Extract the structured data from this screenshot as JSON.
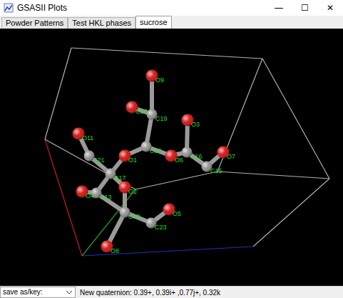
{
  "window": {
    "title": "GSASII Plots",
    "controls": [
      "—",
      "☐",
      "✕"
    ]
  },
  "tabs": [
    {
      "label": "Powder Patterns",
      "selected": false
    },
    {
      "label": "Test HKL phases",
      "selected": false
    },
    {
      "label": "sucrose",
      "selected": true
    }
  ],
  "molecule": {
    "atoms": [
      {
        "label": "O9",
        "color": "#d40000"
      },
      {
        "label": "O10",
        "color": "#d40000"
      },
      {
        "label": "C19",
        "color": "#8a8a8a"
      },
      {
        "label": "O3",
        "color": "#d40000"
      },
      {
        "label": "C12",
        "color": "#8a8a8a"
      },
      {
        "label": "O1",
        "color": "#d40000"
      },
      {
        "label": "O6",
        "color": "#d40000"
      },
      {
        "label": "C16",
        "color": "#8a8a8a"
      },
      {
        "label": "O7",
        "color": "#d40000"
      },
      {
        "label": "C15",
        "color": "#8a8a8a"
      },
      {
        "label": "O11",
        "color": "#d40000"
      },
      {
        "label": "C21",
        "color": "#8a8a8a"
      },
      {
        "label": "C17",
        "color": "#8a8a8a"
      },
      {
        "label": "O2",
        "color": "#d40000"
      },
      {
        "label": "C13",
        "color": "#8a8a8a"
      },
      {
        "label": "O4",
        "color": "#d40000"
      },
      {
        "label": "C18",
        "color": "#8a8a8a"
      },
      {
        "label": "C23",
        "color": "#8a8a8a"
      },
      {
        "label": "O5",
        "color": "#d40000"
      },
      {
        "label": "O8",
        "color": "#d40000"
      }
    ]
  },
  "status_bar": {
    "dropdown": "save as/key:",
    "message": "New quaternion: 0.39+, 0.39i+ ,0.77j+, 0.32k"
  }
}
